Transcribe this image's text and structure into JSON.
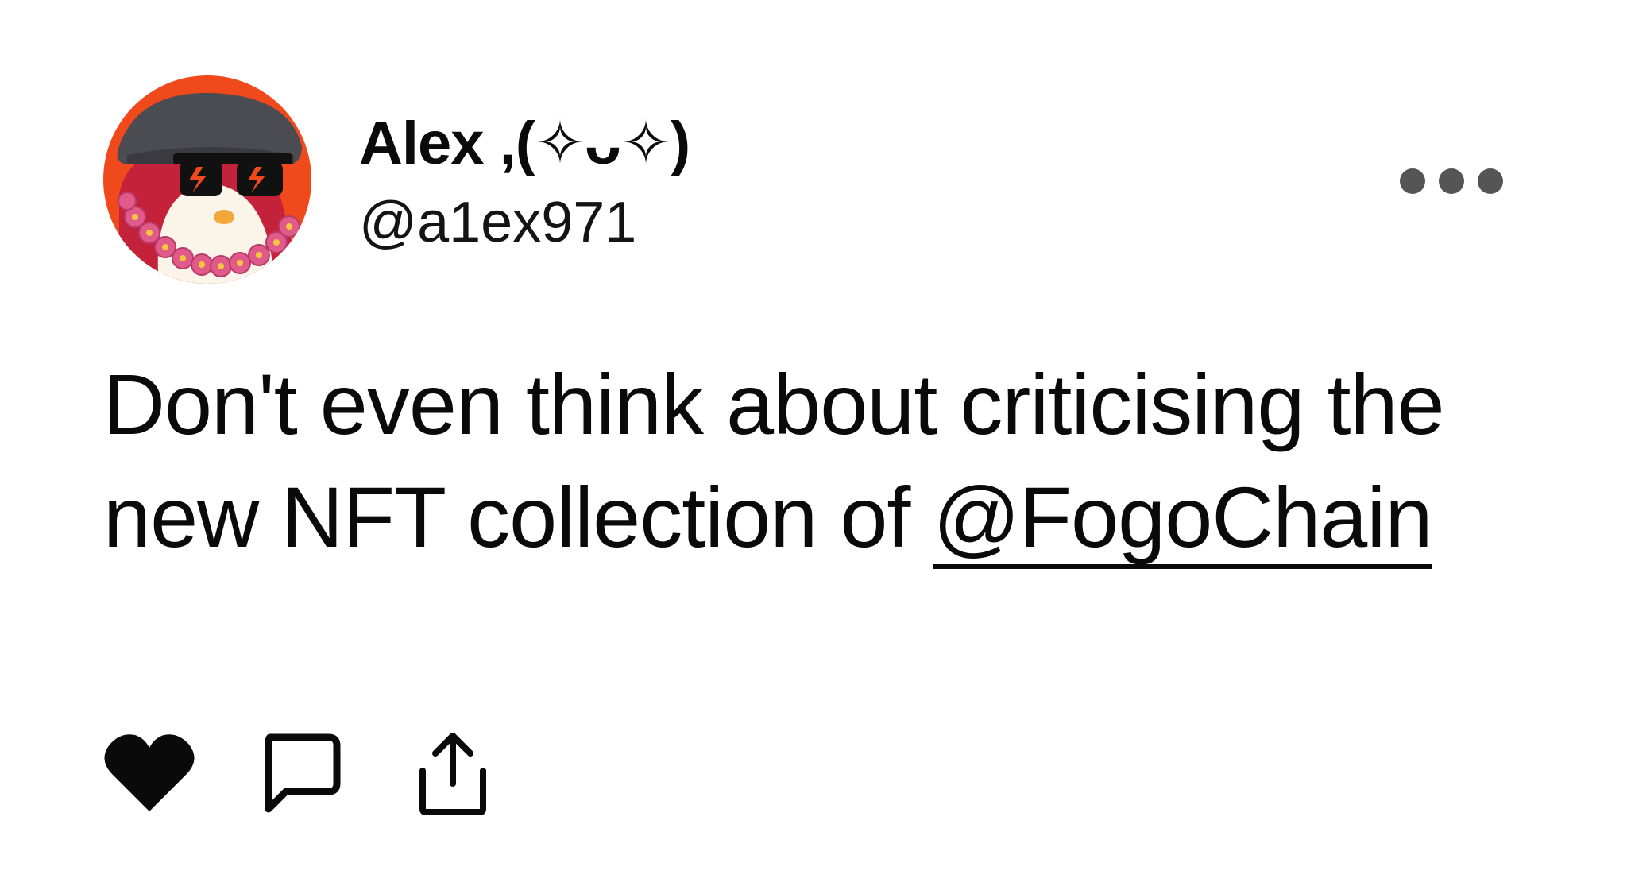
{
  "post": {
    "author": {
      "display_name": "Alex ,(✧ᴗ✧)",
      "handle": "@a1ex971",
      "avatar_icon": "penguin-avatar-icon"
    },
    "text_before": "Don't even think about criticising the new NFT collection of ",
    "mention": "@FogoChain",
    "more_icon": "more-dots-icon",
    "actions": {
      "like_icon": "heart-icon",
      "reply_icon": "comment-icon",
      "share_icon": "share-icon"
    }
  },
  "colors": {
    "avatar_background": "#f04a1c",
    "text": "#0a0a0a",
    "more_dots": "#555555"
  }
}
